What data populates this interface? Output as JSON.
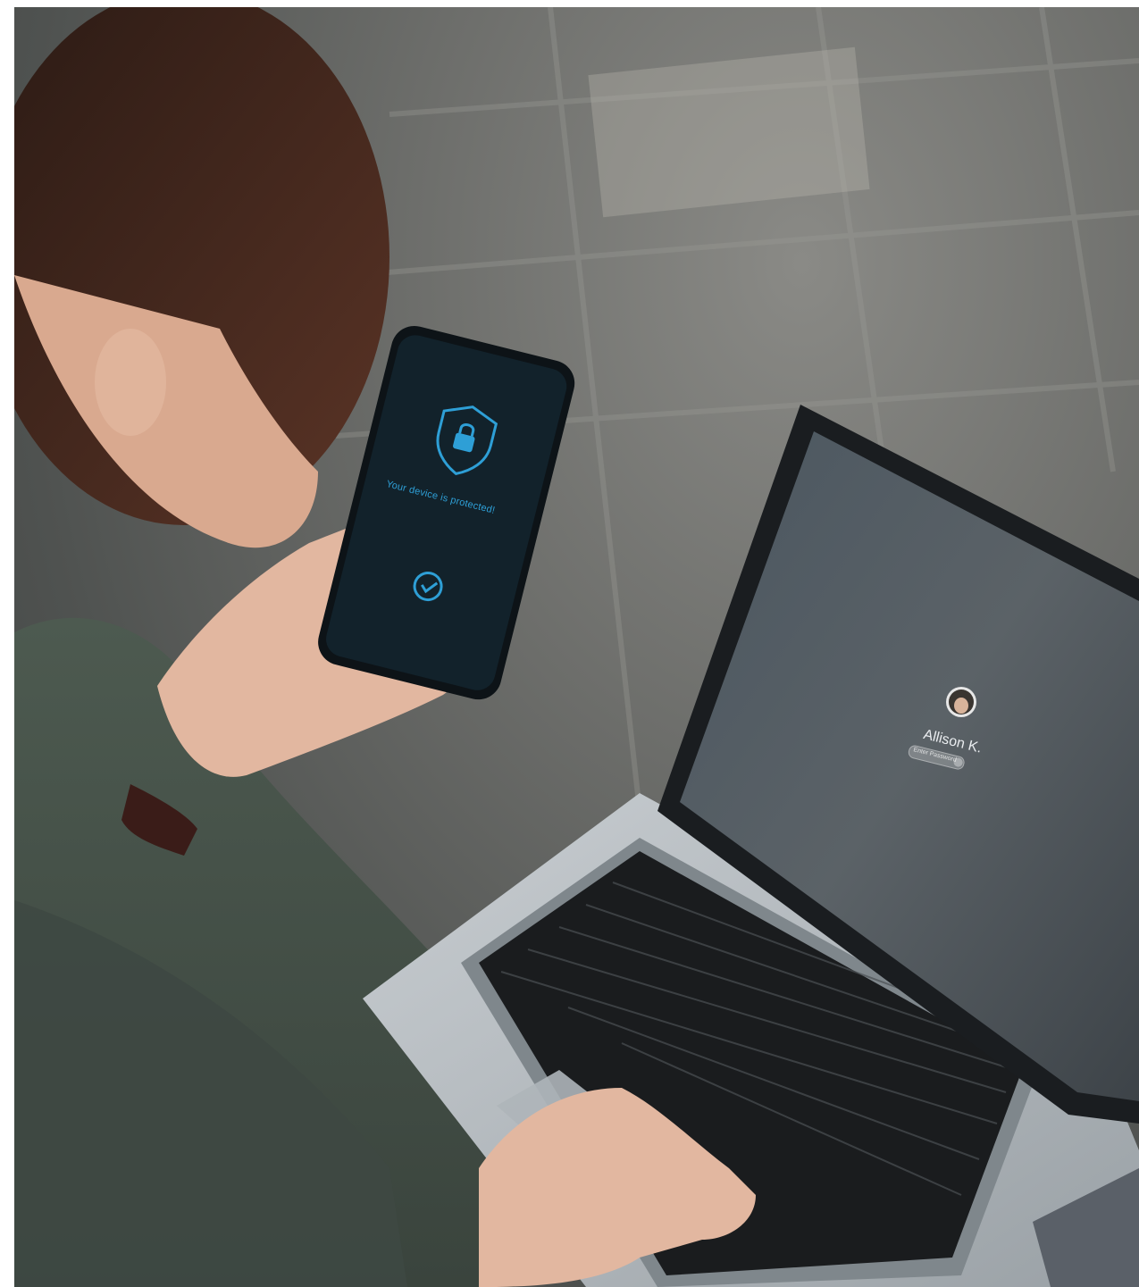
{
  "photo": {
    "phone_screen": {
      "shield_icon": "shield-lock-icon",
      "status_text": "Your device is protected!",
      "check_icon": "checkmark-circle-icon",
      "accent_color": "#2e9fd6"
    },
    "laptop_screen": {
      "user_name": "Allison K.",
      "password_placeholder": "Enter Password",
      "avatar_icon": "user-avatar-icon"
    }
  }
}
